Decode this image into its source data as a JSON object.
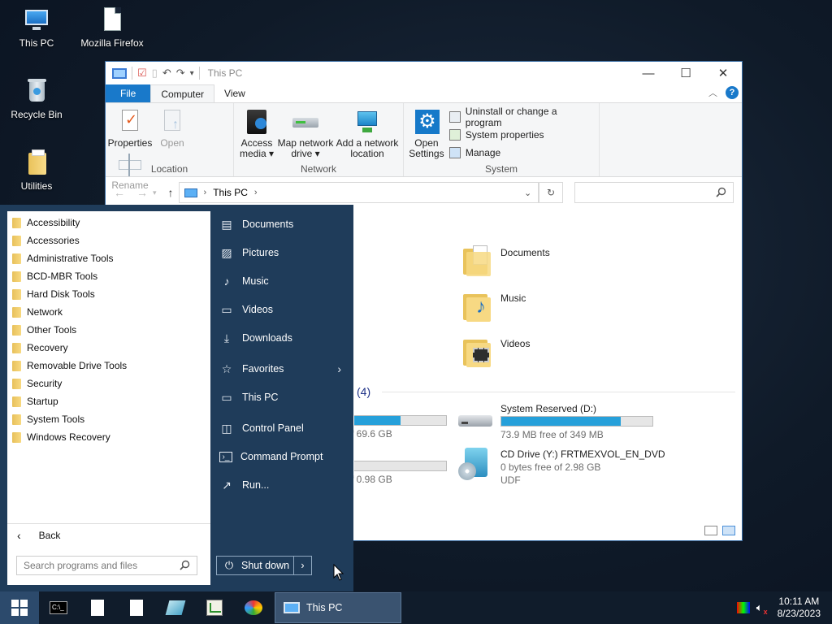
{
  "desktop": {
    "icons": [
      {
        "label": "This PC"
      },
      {
        "label": "Mozilla Firefox"
      },
      {
        "label": "Recycle Bin"
      },
      {
        "label": "Utilities"
      }
    ]
  },
  "explorer": {
    "title": "This PC",
    "tabs": {
      "file": "File",
      "computer": "Computer",
      "view": "View"
    },
    "ribbon": {
      "location": {
        "label": "Location",
        "properties": "Properties",
        "open": "Open",
        "rename": "Rename"
      },
      "network": {
        "label": "Network",
        "access_media": "Access media ▾",
        "map_drive": "Map network drive ▾",
        "add_location": "Add a network location"
      },
      "system": {
        "label": "System",
        "open_settings": "Open Settings",
        "uninstall": "Uninstall or change a program",
        "sysprops": "System properties",
        "manage": "Manage"
      }
    },
    "address": {
      "path": "This PC"
    },
    "folders": [
      {
        "name": "Documents"
      },
      {
        "name": "Music"
      },
      {
        "name": "Videos"
      }
    ],
    "devices_count": "(4)",
    "drives": [
      {
        "name": "System Reserved (D:)",
        "sub": "73.9 MB free of 349 MB",
        "used_fraction": 0.79
      },
      {
        "name": "CD Drive (Y:) FRTMEXVOL_EN_DVD",
        "sub": "0 bytes free of 2.98 GB",
        "fs": "UDF"
      }
    ],
    "partial_drives": [
      {
        "text": "f 69.6 GB",
        "used_fraction": 0.5
      },
      {
        "text": "f 0.98 GB",
        "used_fraction": 0.0
      }
    ]
  },
  "start_menu": {
    "programs": [
      "Accessibility",
      "Accessories",
      "Administrative Tools",
      "BCD-MBR Tools",
      "Hard Disk Tools",
      "Network",
      "Other Tools",
      "Recovery",
      "Removable Drive Tools",
      "Security",
      "Startup",
      "System Tools",
      "Windows Recovery"
    ],
    "back": "Back",
    "search_placeholder": "Search programs and files",
    "right_items": {
      "documents": "Documents",
      "pictures": "Pictures",
      "music": "Music",
      "videos": "Videos",
      "downloads": "Downloads",
      "favorites": "Favorites",
      "this_pc": "This PC",
      "control_panel": "Control Panel",
      "command_prompt": "Command Prompt",
      "run": "Run..."
    },
    "shutdown": "Shut down"
  },
  "taskbar": {
    "active_window": "This PC",
    "time": "10:11 AM",
    "date": "8/23/2023"
  }
}
